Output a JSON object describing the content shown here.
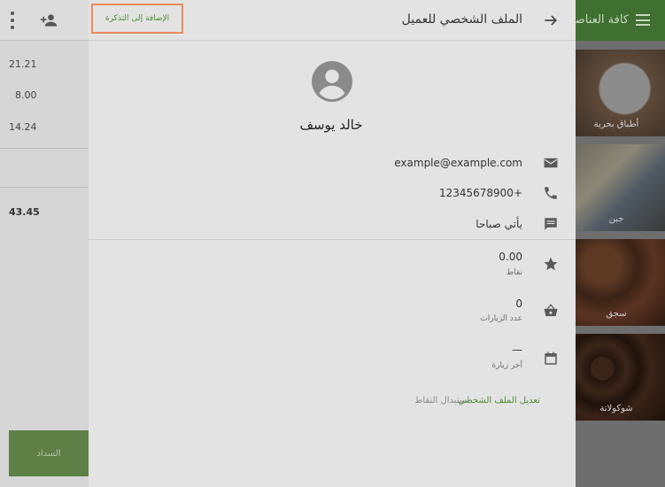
{
  "background": {
    "left": {
      "amounts": [
        "21.21",
        "8.00",
        "14.24"
      ],
      "total": "43.45",
      "pay_label": "السداد"
    },
    "right": {
      "title": "كافة العناصر",
      "tiles": [
        "أطباق بحرية",
        "جبن",
        "سجق",
        "شوكولاتة"
      ]
    }
  },
  "panel": {
    "title": "الملف الشخصي للعميل",
    "add_to_favorites": "الإضافة إلى التذكرة",
    "customer": {
      "name": "خالد يوسف",
      "email": "example@example.com",
      "phone": "+12345678900",
      "note": "يأتي صباحا"
    },
    "stats": {
      "points_value": "0.00",
      "points_label": "نقاط",
      "visits_value": "0",
      "visits_label": "عدد الزيارات",
      "last_visit_value": "—",
      "last_visit_label": "آخر زيارة"
    },
    "actions": {
      "edit_profile": "تعديل الملف الشخصي",
      "redeem_points": "استبدال النقاط"
    }
  },
  "colors": {
    "accent_green": "#4d8b34",
    "highlight_orange": "#ed8a5a",
    "icon_gray": "#5a5a5a"
  }
}
